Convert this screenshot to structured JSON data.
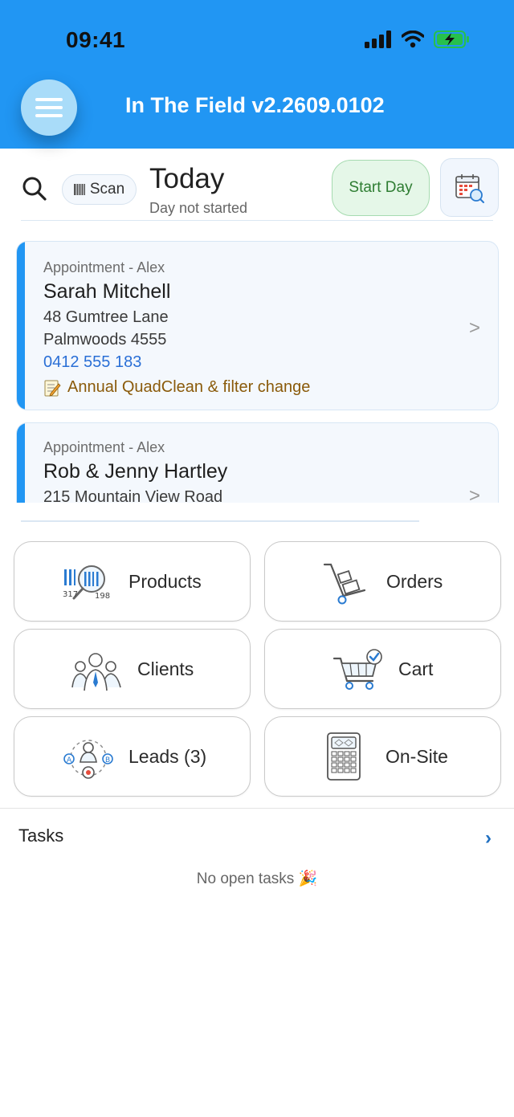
{
  "status_bar": {
    "time": "09:41"
  },
  "header": {
    "title": "In The Field v2.2609.0102"
  },
  "toolbar": {
    "scan_label": "Scan",
    "day_title": "Today",
    "day_status": "Day not started",
    "start_day_label": "Start Day"
  },
  "appointments": [
    {
      "label": "Appointment - Alex",
      "name": "Sarah Mitchell",
      "address_line1": "48 Gumtree Lane",
      "address_line2": "Palmwoods 4555",
      "phone": "0412 555 183",
      "note": "Annual QuadClean & filter change",
      "chevron": ">"
    },
    {
      "label": "Appointment - Alex",
      "name": "Rob & Jenny Hartley",
      "address_line1": "215 Mountain View Road",
      "chevron": ">"
    }
  ],
  "grid": {
    "products": "Products",
    "orders": "Orders",
    "clients": "Clients",
    "cart": "Cart",
    "leads": "Leads (3)",
    "onsite": "On-Site"
  },
  "tasks": {
    "title": "Tasks",
    "chevron": "›",
    "empty_text": "No open tasks 🎉"
  },
  "colors": {
    "header": "#2196f3",
    "accent_bar": "#2196f3",
    "start_day_bg": "#e5f7e8",
    "start_day_text": "#2e7d32",
    "phone_link": "#2a6fd6",
    "note_text": "#8a5a0a"
  },
  "icons": {
    "menu": "hamburger-icon",
    "search": "search-icon",
    "scan": "barcode-icon",
    "calendar": "calendar-search-icon",
    "note": "memo-icon"
  }
}
